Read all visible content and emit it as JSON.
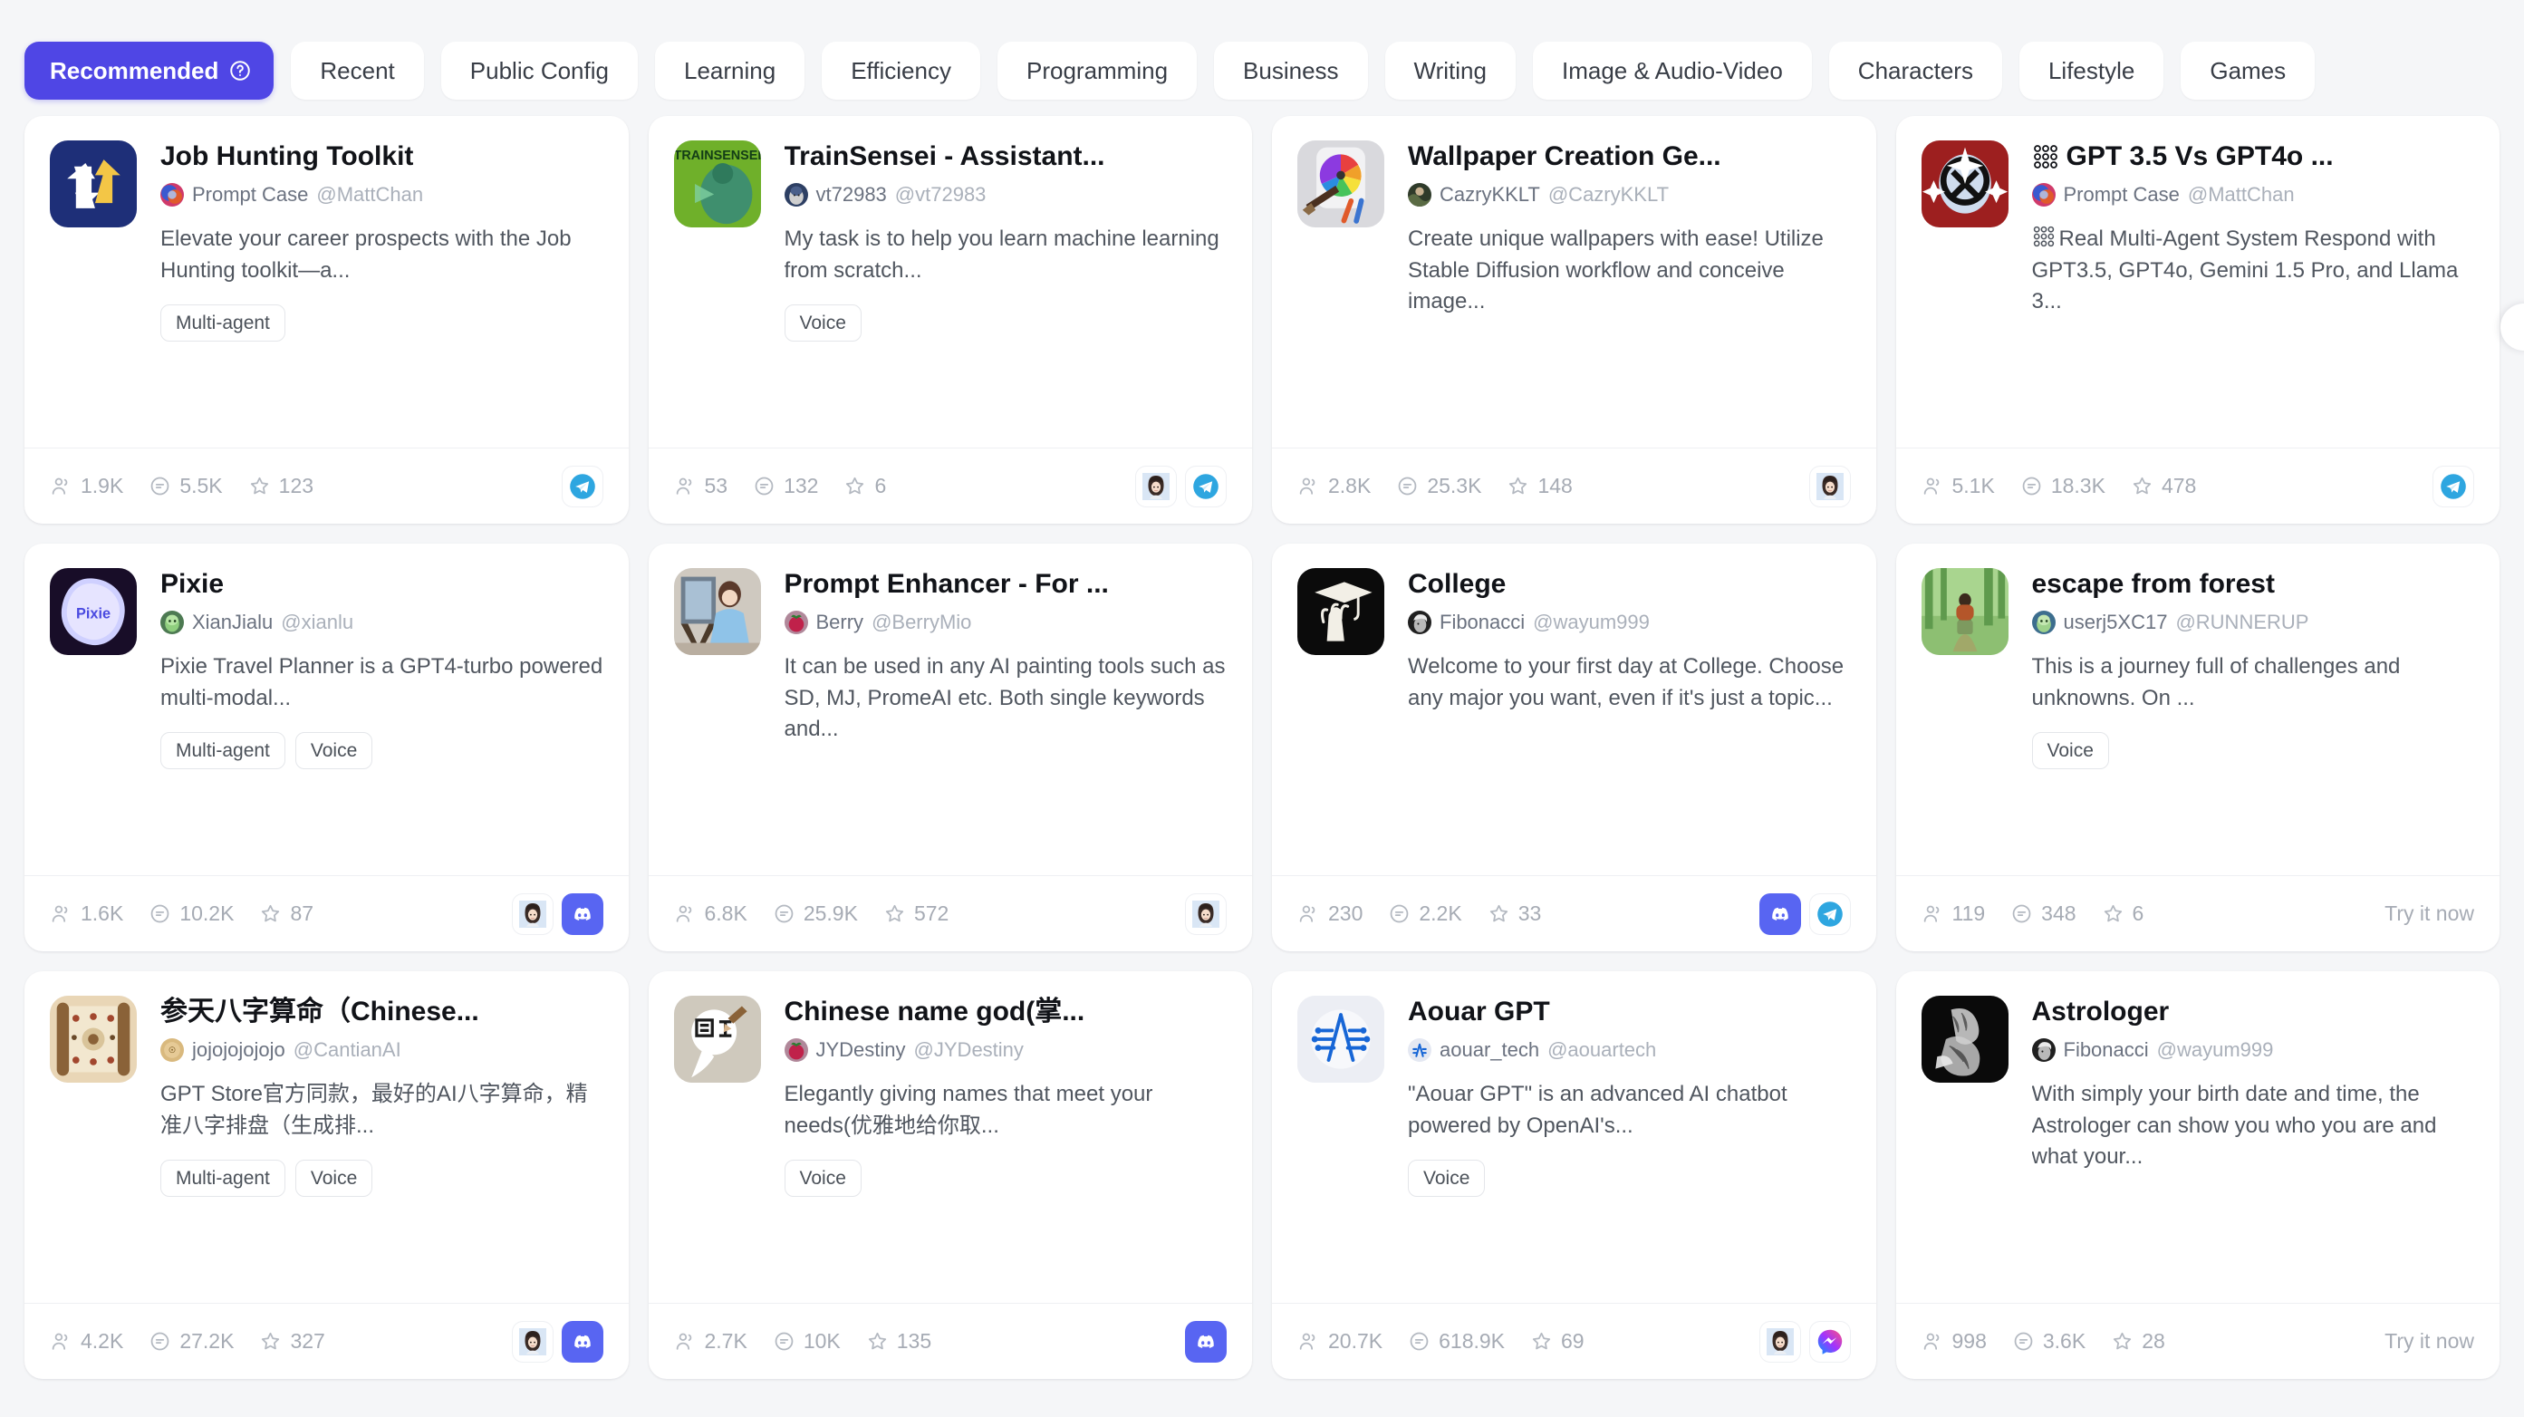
{
  "tabs": [
    {
      "label": "Recommended",
      "active": true,
      "icon": "question-circle-icon"
    },
    {
      "label": "Recent",
      "active": false
    },
    {
      "label": "Public Config",
      "active": false
    },
    {
      "label": "Learning",
      "active": false
    },
    {
      "label": "Efficiency",
      "active": false
    },
    {
      "label": "Programming",
      "active": false
    },
    {
      "label": "Business",
      "active": false
    },
    {
      "label": "Writing",
      "active": false
    },
    {
      "label": "Image & Audio-Video",
      "active": false
    },
    {
      "label": "Characters",
      "active": false
    },
    {
      "label": "Lifestyle",
      "active": false
    },
    {
      "label": "Games",
      "active": false
    }
  ],
  "colors": {
    "accent": "#4f46e5",
    "page_bg": "#f5f6f8",
    "card_bg": "#ffffff",
    "title": "#111318",
    "muted": "#a6abb4",
    "telegram": "#2ea6e0",
    "discord": "#5865f2"
  },
  "cards": [
    {
      "title": "Job Hunting Toolkit",
      "title_emoji": "",
      "author": "Prompt Case",
      "handle": "@MattChan",
      "author_avatar": "promptcase-avatar",
      "desc": "Elevate your career prospects with the Job Hunting toolkit—a...",
      "desc_emoji": "",
      "tags": [
        "Multi-agent"
      ],
      "icon": "job-hunting-toolkit-icon",
      "stats": {
        "users": "1.9K",
        "chats": "5.5K",
        "stars": "123"
      },
      "platforms": [
        "telegram"
      ],
      "try_label": ""
    },
    {
      "title": "TrainSensei - Assistant...",
      "title_emoji": "",
      "author": "vt72983",
      "handle": "@vt72983",
      "author_avatar": "vt72983-avatar",
      "desc": "My task is to help you learn machine learning from scratch...",
      "desc_emoji": "",
      "tags": [
        "Voice"
      ],
      "icon": "trainsensei-icon",
      "stats": {
        "users": "53",
        "chats": "132",
        "stars": "6"
      },
      "platforms": [
        "avatar-girl",
        "telegram"
      ],
      "try_label": ""
    },
    {
      "title": "Wallpaper Creation Ge...",
      "title_emoji": "",
      "author": "CazryKKLT",
      "handle": "@CazryKKLT",
      "author_avatar": "cazrykklt-avatar",
      "desc": "Create unique wallpapers with ease! Utilize Stable Diffusion workflow and conceive image...",
      "desc_emoji": "",
      "tags": [],
      "icon": "wallpaper-creation-icon",
      "stats": {
        "users": "2.8K",
        "chats": "25.3K",
        "stars": "148"
      },
      "platforms": [
        "avatar-girl"
      ],
      "try_label": ""
    },
    {
      "title": "GPT 3.5 Vs GPT4o ...",
      "title_emoji": "dots-grid",
      "author": "Prompt Case",
      "handle": "@MattChan",
      "author_avatar": "promptcase-avatar",
      "desc": "Real Multi-Agent System Respond with GPT3.5, GPT4o, Gemini 1.5 Pro, and Llama 3...",
      "desc_emoji": "dots-grid",
      "tags": [],
      "icon": "gpt-comparison-icon",
      "stats": {
        "users": "5.1K",
        "chats": "18.3K",
        "stars": "478"
      },
      "platforms": [
        "telegram"
      ],
      "try_label": ""
    },
    {
      "title": "Pixie",
      "title_emoji": "",
      "author": "XianJialu",
      "handle": "@xianlu",
      "author_avatar": "xianjialu-avatar",
      "desc": "Pixie Travel Planner is a GPT4-turbo powered multi-modal...",
      "desc_emoji": "",
      "tags": [
        "Multi-agent",
        "Voice"
      ],
      "icon": "pixie-icon",
      "stats": {
        "users": "1.6K",
        "chats": "10.2K",
        "stars": "87"
      },
      "platforms": [
        "avatar-girl",
        "discord"
      ],
      "try_label": ""
    },
    {
      "title": "Prompt Enhancer - For ...",
      "title_emoji": "",
      "author": "Berry",
      "handle": "@BerryMio",
      "author_avatar": "berry-avatar",
      "desc": "It can be used in any AI painting tools such as SD, MJ, PromeAI etc. Both single keywords and...",
      "desc_emoji": "",
      "tags": [],
      "icon": "prompt-enhancer-icon",
      "stats": {
        "users": "6.8K",
        "chats": "25.9K",
        "stars": "572"
      },
      "platforms": [
        "avatar-girl"
      ],
      "try_label": ""
    },
    {
      "title": "College",
      "title_emoji": "",
      "author": "Fibonacci",
      "handle": "@wayum999",
      "author_avatar": "fibonacci-avatar",
      "desc": "Welcome to your first day at College. Choose any major you want, even if it's just a topic...",
      "desc_emoji": "",
      "tags": [],
      "icon": "college-icon",
      "stats": {
        "users": "230",
        "chats": "2.2K",
        "stars": "33"
      },
      "platforms": [
        "discord",
        "telegram"
      ],
      "try_label": ""
    },
    {
      "title": "escape from forest",
      "title_emoji": "",
      "author": "userj5XC17",
      "handle": "@RUNNERUP",
      "author_avatar": "userj5xc17-avatar",
      "desc": "This is a journey full of challenges and unknowns. On ...",
      "desc_emoji": "",
      "tags": [
        "Voice"
      ],
      "icon": "escape-forest-icon",
      "stats": {
        "users": "119",
        "chats": "348",
        "stars": "6"
      },
      "platforms": [],
      "try_label": "Try it now"
    },
    {
      "title": "参天八字算命（Chinese...",
      "title_emoji": "",
      "author": "jojojojojojo",
      "handle": "@CantianAI",
      "author_avatar": "cantianai-avatar",
      "desc": "GPT Store官方同款，最好的AI八字算命，精准八字排盘（生成排...",
      "desc_emoji": "",
      "tags": [
        "Multi-agent",
        "Voice"
      ],
      "icon": "bazi-scroll-icon",
      "stats": {
        "users": "4.2K",
        "chats": "27.2K",
        "stars": "327"
      },
      "platforms": [
        "avatar-girl",
        "discord"
      ],
      "try_label": ""
    },
    {
      "title": "Chinese name god(掌...",
      "title_emoji": "",
      "author": "JYDestiny",
      "handle": "@JYDestiny",
      "author_avatar": "jydestiny-avatar",
      "desc": "Elegantly giving names that meet your needs(优雅地给你取...",
      "desc_emoji": "",
      "tags": [
        "Voice"
      ],
      "icon": "chinese-name-icon",
      "stats": {
        "users": "2.7K",
        "chats": "10K",
        "stars": "135"
      },
      "platforms": [
        "discord"
      ],
      "try_label": ""
    },
    {
      "title": "Aouar GPT",
      "title_emoji": "",
      "author": "aouar_tech",
      "handle": "@aouartech",
      "author_avatar": "aouartech-avatar",
      "desc": "\"Aouar GPT\" is an advanced AI chatbot powered by OpenAI's...",
      "desc_emoji": "",
      "tags": [
        "Voice"
      ],
      "icon": "aouar-gpt-icon",
      "stats": {
        "users": "20.7K",
        "chats": "618.9K",
        "stars": "69"
      },
      "platforms": [
        "avatar-girl",
        "messenger"
      ],
      "try_label": ""
    },
    {
      "title": "Astrologer",
      "title_emoji": "",
      "author": "Fibonacci",
      "handle": "@wayum999",
      "author_avatar": "fibonacci-avatar",
      "desc": "With simply your birth date and time, the Astrologer can show you who you are and what your...",
      "desc_emoji": "",
      "tags": [],
      "icon": "astrologer-icon",
      "stats": {
        "users": "998",
        "chats": "3.6K",
        "stars": "28"
      },
      "platforms": [],
      "try_label": "Try it now"
    }
  ]
}
